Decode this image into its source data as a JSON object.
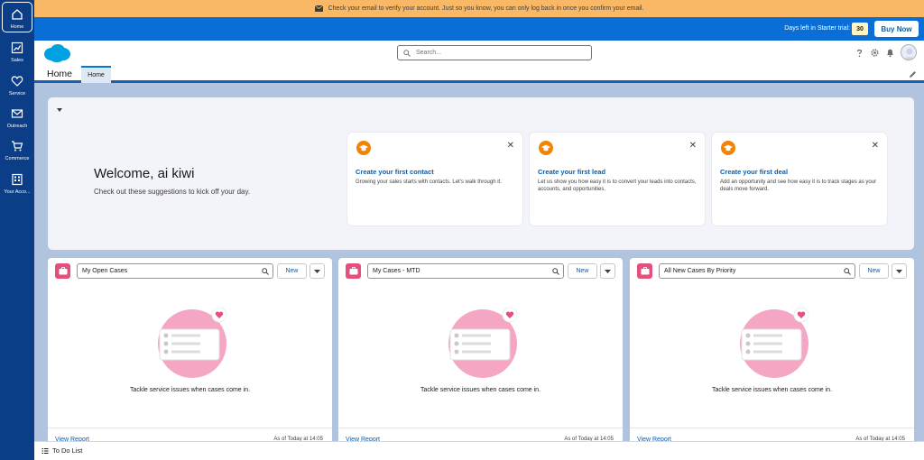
{
  "rail": {
    "items": [
      {
        "label": "Home",
        "icon": "home-icon"
      },
      {
        "label": "Sales",
        "icon": "sales-chart-icon"
      },
      {
        "label": "Service",
        "icon": "heart-icon"
      },
      {
        "label": "Outreach",
        "icon": "envelope-icon"
      },
      {
        "label": "Commerce",
        "icon": "cart-icon"
      },
      {
        "label": "Your Acco...",
        "icon": "building-icon"
      }
    ]
  },
  "banner": {
    "verify_text": "Check your email to verify your account. Just so you know, you can only log back in once you confirm your email."
  },
  "trial": {
    "label": "Days left in Starter trial:",
    "days": "30",
    "buy_label": "Buy Now"
  },
  "header": {
    "search_placeholder": "Search..."
  },
  "nav": {
    "app_name": "Home",
    "tab_label": "Home"
  },
  "welcome": {
    "title": "Welcome, ai kiwi",
    "subtitle": "Check out these suggestions to kick off your day.",
    "cards": [
      {
        "title": "Create your first contact",
        "desc": "Growing your sales starts with contacts. Let's walk through it."
      },
      {
        "title": "Create your first lead",
        "desc": "Let us show you how easy it is to convert your leads into contacts, accounts, and opportunities."
      },
      {
        "title": "Create your first deal",
        "desc": "Add an opportunity and see how easy it is to track stages as your deals move forward."
      }
    ]
  },
  "cases": [
    {
      "list_view": "My Open Cases",
      "new_label": "New",
      "empty_text": "Tackle service issues when cases come in.",
      "view_report": "View Report",
      "as_of": "As of Today at 14:05"
    },
    {
      "list_view": "My Cases - MTD",
      "new_label": "New",
      "empty_text": "Tackle service issues when cases come in.",
      "view_report": "View Report",
      "as_of": "As of Today at 14:05"
    },
    {
      "list_view": "All New Cases By Priority",
      "new_label": "New",
      "empty_text": "Tackle service issues when cases come in.",
      "view_report": "View Report",
      "as_of": "As of Today at 14:05"
    }
  ],
  "utility": {
    "todo_label": "To Do List"
  },
  "colors": {
    "rail": "#0b3e86",
    "banner": "#f8b865",
    "trial_bar": "#0a6ed6",
    "accent": "#0b5cab",
    "suggestion_badge": "#f38303",
    "case_icon": "#e3507c"
  }
}
